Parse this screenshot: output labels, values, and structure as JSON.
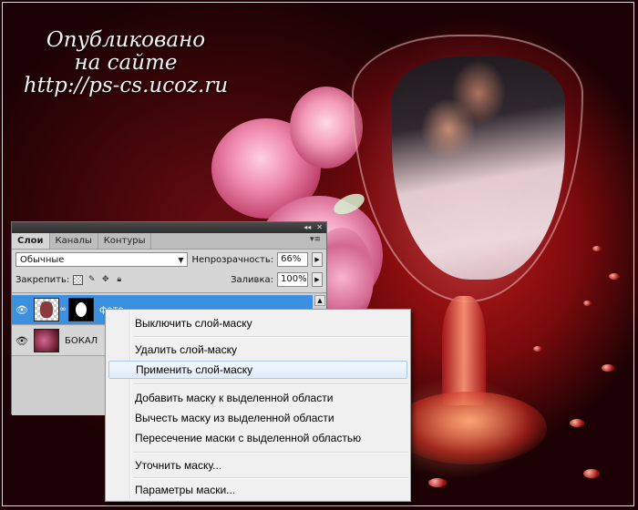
{
  "watermark": {
    "line1": "Опубликовано",
    "line2": "на сайте",
    "line3": "http://ps-cs.ucoz.ru"
  },
  "layers_panel": {
    "tabs": [
      "Слои",
      "Каналы",
      "Контуры"
    ],
    "blend_mode": "Обычные",
    "opacity_label": "Непрозрачность:",
    "opacity_value": "66%",
    "lock_label": "Закрепить:",
    "fill_label": "Заливка:",
    "fill_value": "100%",
    "layers": [
      {
        "name": "фото",
        "selected": true
      },
      {
        "name": "БОКАЛ",
        "selected": false
      }
    ]
  },
  "context_menu": {
    "items": [
      "Выключить слой-маску",
      "Удалить слой-маску",
      "Применить слой-маску",
      "Добавить маску к выделенной области",
      "Вычесть маску из выделенной области",
      "Пересечение маски с выделенной областью",
      "Уточнить маску...",
      "Параметры маски..."
    ],
    "highlighted": "Применить слой-маску"
  },
  "colors": {
    "selection": "#3d8fe0",
    "menu_background": "#f0f0f0",
    "panel_background": "#d6d6d6"
  }
}
